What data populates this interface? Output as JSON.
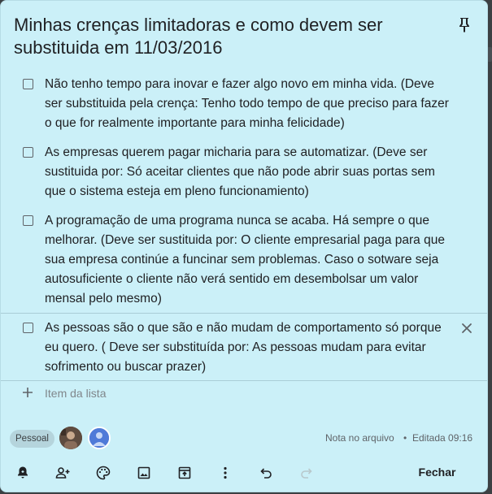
{
  "note": {
    "title": "Minhas crenças limitadoras e como devem ser substituida em 11/03/2016",
    "items": [
      {
        "text": "Não tenho tempo para inovar e fazer algo novo em minha vida. (Deve ser substituida pela crença: Tenho todo tempo de que preciso para fazer o que for realmente importante para minha felicidade)",
        "checked": false
      },
      {
        "text": "As empresas querem pagar micharia para se automatizar. (Deve ser sustituida por:  Só aceitar clientes que não pode abrir suas portas sem que o sistema esteja em pleno funcionamiento)",
        "checked": false
      },
      {
        "text": "A programação de uma programa nunca se acaba. Há sempre o que melhorar. (Deve ser sustituida por: O cliente empresarial paga para que sua empresa continúe a funcinar sem problemas. Caso o sotware seja autosuficiente o cliente não verá sentido em desembolsar um valor mensal pelo mesmo)",
        "checked": false
      },
      {
        "text": "As pessoas são o que são e não mudam de comportamento só porque eu quero. ( Deve ser substituída por:  As pessoas mudam para evitar sofrimento ou buscar prazer)",
        "checked": false
      }
    ],
    "add_item_placeholder": "Item da lista",
    "label_chip": "Pessoal",
    "status": "Nota no arquivo",
    "edited": "Editada 09:16",
    "close_label": "Fechar",
    "background_color": "#cbf0f8"
  },
  "icons": {
    "pin": "pin-icon",
    "toolbar": [
      "reminder-icon",
      "collaborator-icon",
      "palette-icon",
      "image-icon",
      "unarchive-icon",
      "more-icon",
      "undo-icon",
      "redo-icon"
    ]
  }
}
